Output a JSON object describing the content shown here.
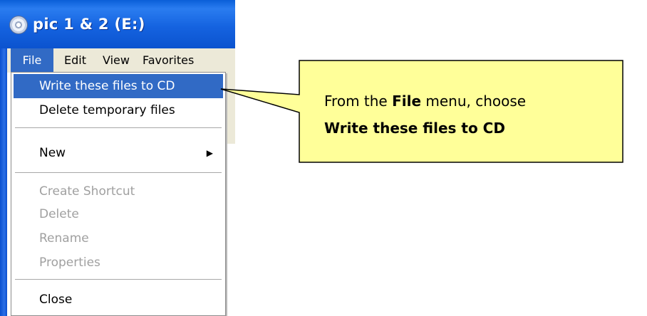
{
  "window": {
    "title": "pic 1 & 2 (E:)"
  },
  "menu_bar": {
    "items": [
      "File",
      "Edit",
      "View",
      "Favorites"
    ]
  },
  "file_menu": {
    "items": [
      {
        "label": "Write these files to CD",
        "state": "selected"
      },
      {
        "label": "Delete temporary files",
        "state": "enabled"
      },
      {
        "label": "New",
        "state": "enabled",
        "submenu": true
      },
      {
        "label": "Create Shortcut",
        "state": "disabled"
      },
      {
        "label": "Delete",
        "state": "disabled"
      },
      {
        "label": "Rename",
        "state": "disabled"
      },
      {
        "label": "Properties",
        "state": "disabled"
      },
      {
        "label": "Close",
        "state": "enabled"
      }
    ]
  },
  "callout": {
    "line1_prefix": "From the",
    "line1_bold": "File",
    "line1_suffix": "menu, choose",
    "line2_bold": "Write these files to CD"
  },
  "colors": {
    "title_bar": "#1563e0",
    "menu_highlight": "#316ac5",
    "callout_fill": "#ffff99",
    "disabled_text": "#a0a0a0"
  },
  "icons": {
    "window": "cd-drive-icon",
    "submenu": "triangle-right-icon"
  }
}
